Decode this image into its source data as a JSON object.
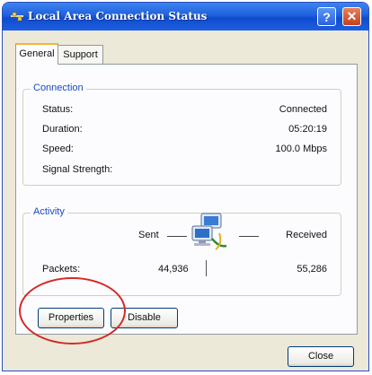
{
  "window": {
    "title": "Local Area Connection Status",
    "help_label": "?",
    "close_label": "✕"
  },
  "tabs": [
    {
      "label": "General",
      "active": true
    },
    {
      "label": "Support",
      "active": false
    }
  ],
  "connection": {
    "title": "Connection",
    "rows": [
      {
        "label": "Status:",
        "value": "Connected"
      },
      {
        "label": "Duration:",
        "value": "05:20:19"
      },
      {
        "label": "Speed:",
        "value": "100.0 Mbps"
      },
      {
        "label": "Signal Strength:",
        "value": ""
      }
    ]
  },
  "activity": {
    "title": "Activity",
    "sent_label": "Sent",
    "received_label": "Received",
    "packets_label": "Packets:",
    "packets_sent": "44,936",
    "packets_received": "55,286",
    "icon": "network-computers-icon"
  },
  "buttons": {
    "properties": "Properties",
    "disable": "Disable",
    "close": "Close"
  },
  "colors": {
    "titlebar": "#2060de",
    "group_title": "#1b4ac0",
    "highlight_circle": "#d42a2a"
  }
}
